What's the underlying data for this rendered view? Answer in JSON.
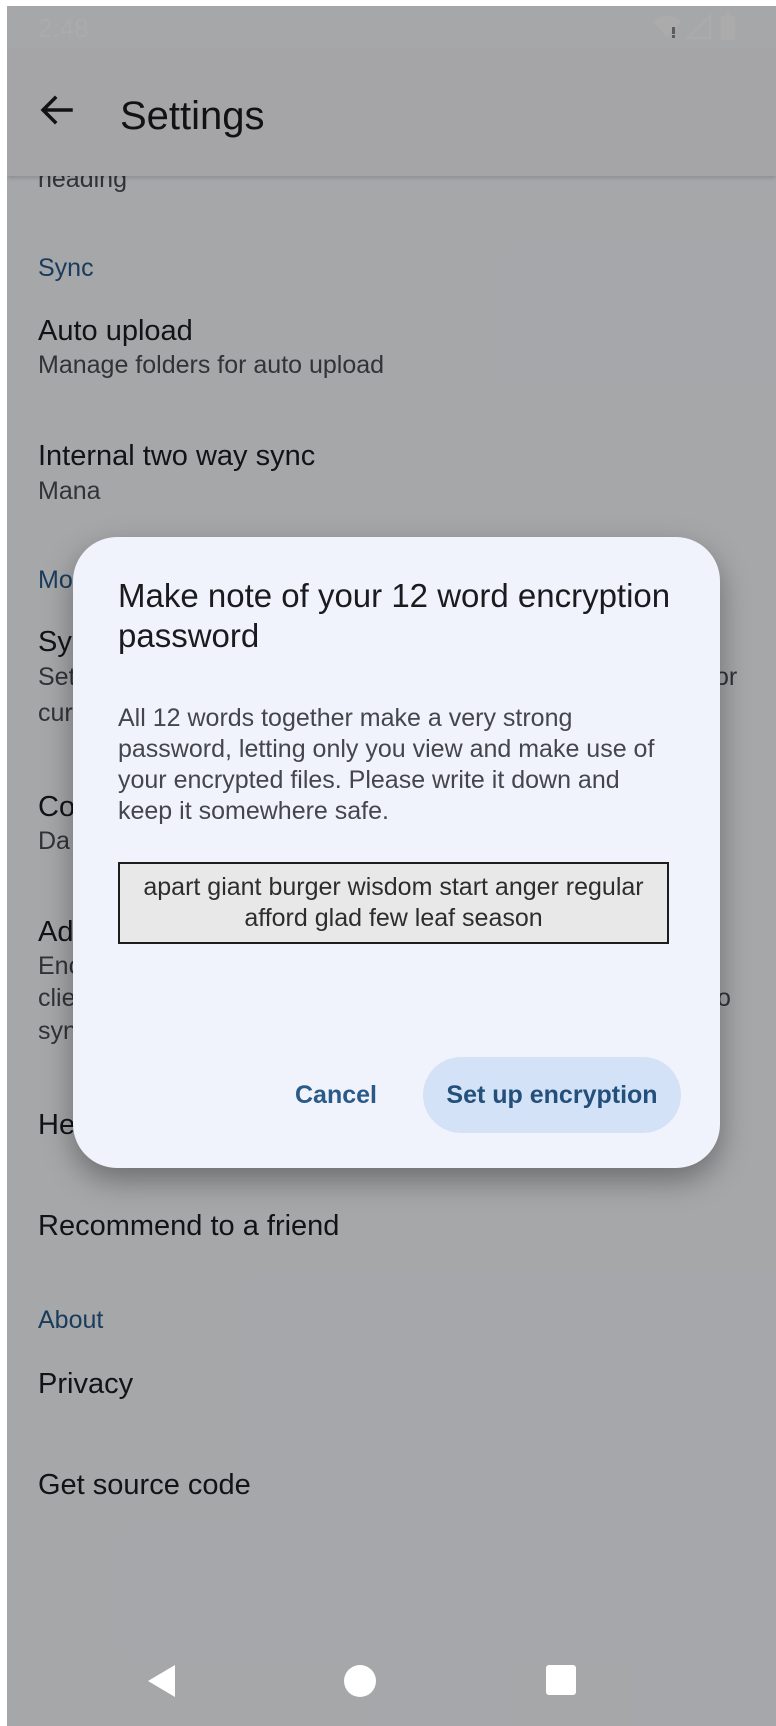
{
  "status_bar": {
    "time": "2:48",
    "icons": [
      "wifi-icon",
      "signal-icon",
      "battery-icon"
    ]
  },
  "app_bar": {
    "title": "Settings",
    "back_icon": "arrow-back-icon"
  },
  "settings": {
    "partial_summary": "heading",
    "sync_header": "Sync",
    "auto_upload": {
      "title": "Auto upload",
      "summary": "Manage folders for auto upload"
    },
    "internal_sync": {
      "title": "Internal two way sync",
      "summary": "Mana"
    },
    "more_header": "Mo",
    "sy_item": {
      "title": "Sy",
      "summary_1": "Set",
      "summary_2": "cur",
      "trailing": "or"
    },
    "co_item": {
      "title": "Co",
      "summary": "Da"
    },
    "ad_item": {
      "title": "Ad",
      "summary_1": "Enc",
      "summary_2": "clie",
      "summary_3": "syn",
      "trailing": "o"
    },
    "help": "Help",
    "recommend": "Recommend to a friend",
    "about_header": "About",
    "privacy": "Privacy",
    "source_code": "Get source code"
  },
  "dialog": {
    "title": "Make note of your 12 word encryption password",
    "message": "All 12 words together make a very strong password, letting only you view and make use of your encrypted files. Please write it down and keep it somewhere safe.",
    "passphrase": "apart giant burger wisdom start anger regular afford glad few leaf season",
    "cancel_label": "Cancel",
    "confirm_label": "Set up encryption"
  },
  "nav_bar": {
    "back": "nav-back-icon",
    "home": "nav-home-icon",
    "recents": "nav-recents-icon"
  },
  "colors": {
    "accent": "#285a8a",
    "dialog_bg": "#f1f3fc",
    "tonal_button": "#d3e2f6"
  }
}
